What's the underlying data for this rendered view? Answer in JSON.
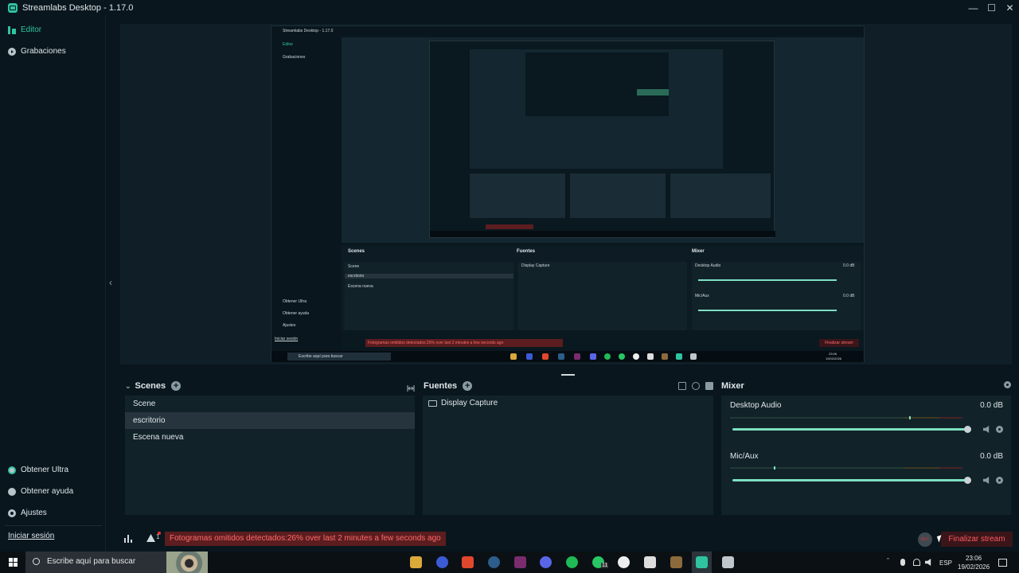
{
  "window": {
    "title": "Streamlabs Desktop - 1.17.0",
    "controls": [
      "minimize",
      "maximize",
      "close"
    ]
  },
  "sidebar": {
    "top_items": [
      {
        "label": "Editor",
        "icon": "editor-icon",
        "active": true
      },
      {
        "label": "Grabaciones",
        "icon": "recordings-icon",
        "active": false
      }
    ],
    "bottom_items": [
      {
        "label": "Obtener Ultra",
        "icon": "ultra-icon"
      },
      {
        "label": "Obtener ayuda",
        "icon": "help-icon"
      },
      {
        "label": "Ajustes",
        "icon": "gear-icon"
      }
    ],
    "login_label": "Iniciar sesión"
  },
  "preview": {
    "nested_title": "Streamlabs Desktop - 1.17.0",
    "nested_editor": "Editor",
    "nested_recordings": "Grabaciones",
    "nested_obtener_ultra": "Obtener Ultra",
    "nested_obtener_ayuda": "Obtener ayuda",
    "nested_ajustes": "Ajustes",
    "nested_login": "Iniciar sesión",
    "nested_scenes_header": "Scenes",
    "nested_sources_header": "Fuentes",
    "nested_mixer_header": "Mixer",
    "nested_scene_rows": [
      "Scene",
      "escritorio",
      "Escena nueva"
    ],
    "nested_source_row": "Display Capture",
    "nested_desktop_audio": "Desktop Audio",
    "nested_mic": "Mic/Aux",
    "nested_db": "0.0 dB",
    "nested_alert": "Fotogramas omitidos detectados:26% over last 2 minutes a few seconds ago",
    "nested_end_stream": "Finalizar stream",
    "nested_search": "Escribe aquí para buscar",
    "nested_time": "23:06",
    "nested_date": "19/02/2026"
  },
  "scenes": {
    "header": "Scenes",
    "items": [
      {
        "label": "Scene",
        "selected": false
      },
      {
        "label": "escritorio",
        "selected": true
      },
      {
        "label": "Escena nueva",
        "selected": false
      }
    ]
  },
  "sources": {
    "header": "Fuentes",
    "items": [
      {
        "label": "Display Capture",
        "icon": "monitor-icon"
      }
    ]
  },
  "mixer": {
    "header": "Mixer",
    "channels": [
      {
        "name": "Desktop Audio",
        "db": "0.0 dB",
        "meter_level": 0.77,
        "volume": 1.0
      },
      {
        "name": "Mic/Aux",
        "db": "0.0 dB",
        "meter_level": 0.19,
        "volume": 1.0
      }
    ]
  },
  "statusbar": {
    "warning_count": "1",
    "alert": "Fotogramas omitidos detectados:26% over last 2 minutes a few seconds ago",
    "rec_label": "REC",
    "end_stream_label": "Finalizar stream"
  },
  "taskbar": {
    "search_placeholder": "Escribe aquí para buscar",
    "lang": "ESP",
    "time": "23:06",
    "date": "19/02/2026",
    "notification_badge": "11",
    "apps": [
      "file-explorer-icon",
      "app-icon",
      "brave-icon",
      "steam-icon",
      "vegas-icon",
      "discord-icon",
      "spotify-icon",
      "whatsapp-icon",
      "clock-icon",
      "minecraft-icon",
      "chest-icon",
      "streamlabs-icon",
      "notes-icon"
    ]
  },
  "colors": {
    "background": "#09161d",
    "panel": "#122229",
    "accent": "#31c3a2",
    "alert_bg": "#5b1d1f",
    "alert_text": "#ff6a6a"
  }
}
